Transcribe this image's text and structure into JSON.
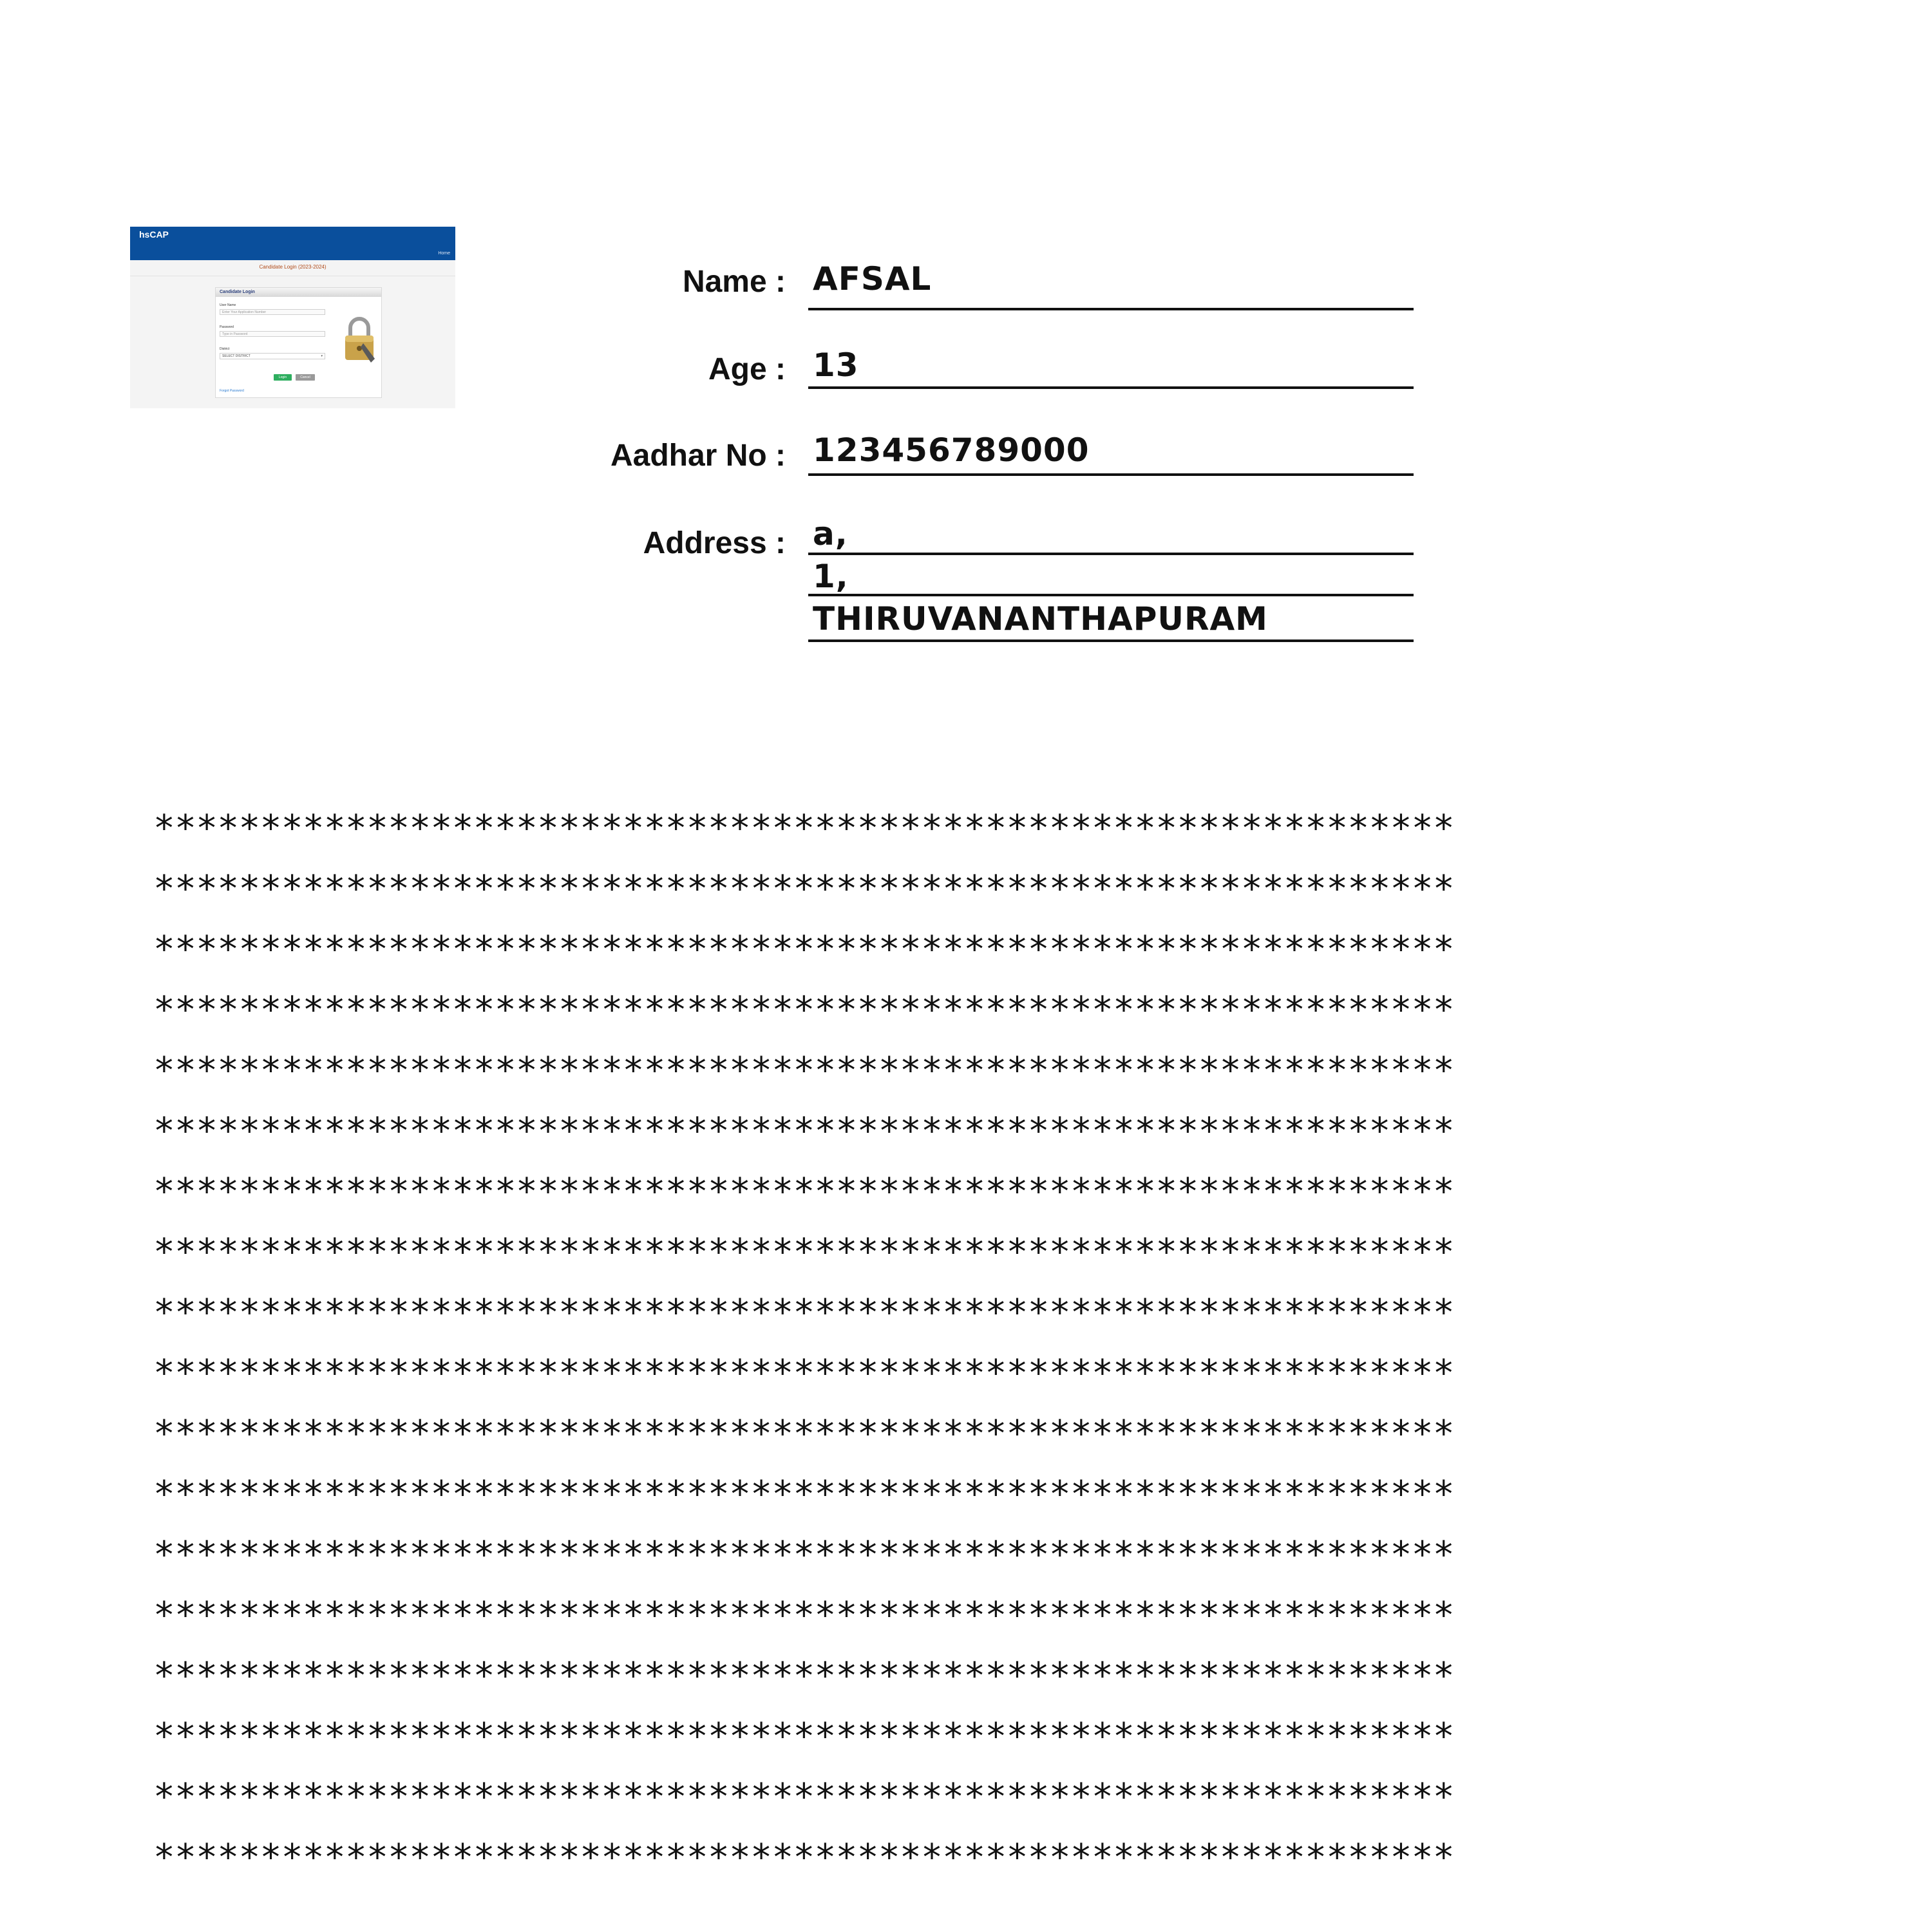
{
  "thumbnail": {
    "brand": "hsCAP",
    "nav_link": "Home",
    "heading": "Candidate Login (2023-2024)",
    "card_title": "Candidate Login",
    "username_label": "User Name",
    "username_placeholder": "Enter Your Application Number",
    "password_label": "Password",
    "password_placeholder": "Type in Password",
    "district_label": "District",
    "district_selected": "SELECT DISTRICT",
    "login_button": "Login",
    "cancel_button": "Cancel",
    "forgot_link": "Forgot Password",
    "lock_icon": "padlock-icon",
    "colors": {
      "header": "#0a4f9c",
      "heading": "#b04a18",
      "login": "#2eae5f",
      "cancel": "#9a9a9a"
    }
  },
  "form": {
    "name_label": "Name :",
    "name_value": "AFSAL",
    "age_label": "Age :",
    "age_value": "13",
    "aadhar_label": "Aadhar No :",
    "aadhar_value": "123456789000",
    "address_label": "Address :",
    "address_line1": "a,",
    "address_line2": "1,",
    "address_line3": "THIRUVANANTHAPURAM"
  },
  "masked_lines": [
    "*************************************************************",
    "*************************************************************",
    "*************************************************************",
    "*************************************************************",
    "*************************************************************",
    "*************************************************************",
    "*************************************************************",
    "*************************************************************",
    "*************************************************************",
    "*************************************************************",
    "*************************************************************",
    "*************************************************************",
    "*************************************************************",
    "*************************************************************",
    "*************************************************************",
    "*************************************************************",
    "*************************************************************",
    "*************************************************************"
  ]
}
